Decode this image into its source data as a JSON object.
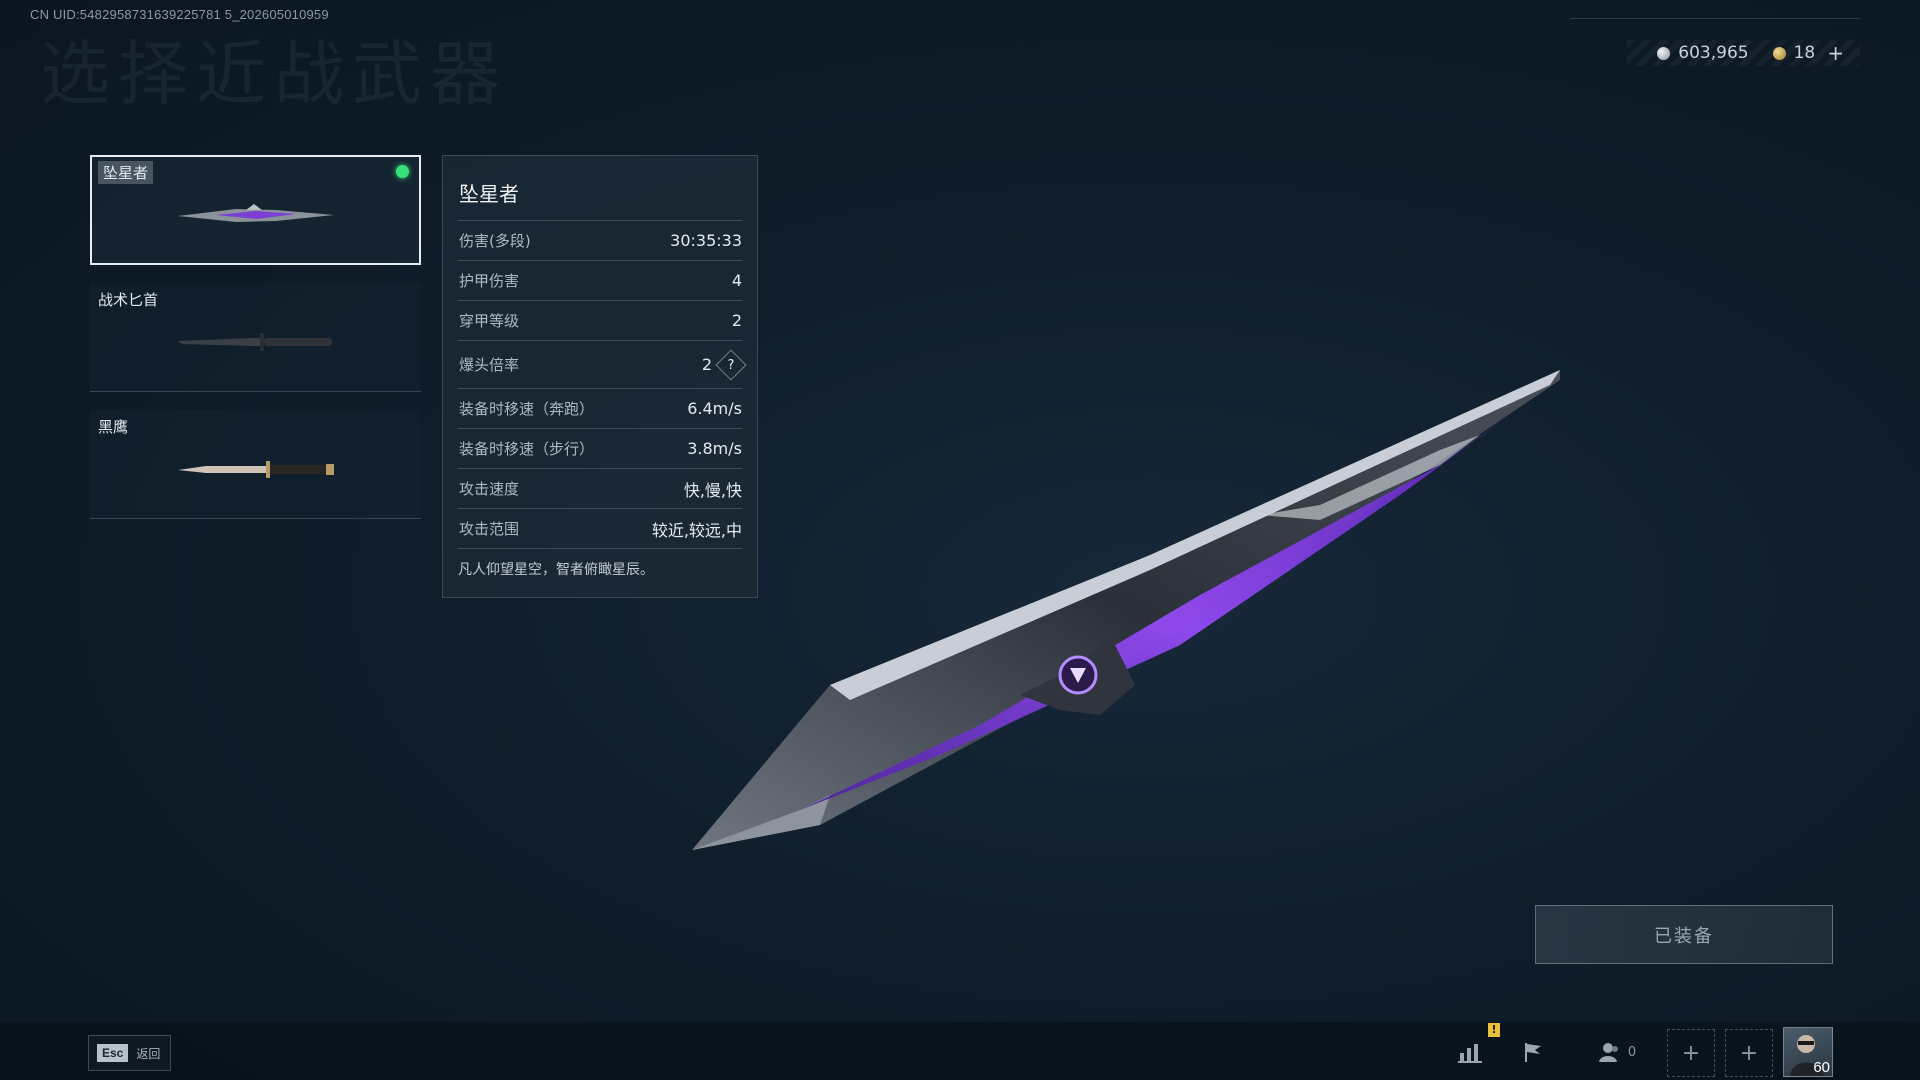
{
  "uid_text": "CN UID:5482958731639225781 5_202605010959",
  "page": {
    "ghost_title": "选择近战武器"
  },
  "currency": [
    {
      "icon": "silver-coin-icon",
      "value": "603,965"
    },
    {
      "icon": "gold-coin-icon",
      "value": "18"
    }
  ],
  "currency_plus": "+",
  "weapons": [
    {
      "name": "坠星者",
      "selected": true,
      "equipped": true
    },
    {
      "name": "战术匕首",
      "selected": false,
      "equipped": false
    },
    {
      "name": "黑鹰",
      "selected": false,
      "equipped": false
    }
  ],
  "stats": {
    "title": "坠星者",
    "rows": [
      {
        "label": "伤害(多段)",
        "value": "30:35:33"
      },
      {
        "label": "护甲伤害",
        "value": "4"
      },
      {
        "label": "穿甲等级",
        "value": "2"
      },
      {
        "label": "爆头倍率",
        "value": "2",
        "help": "?"
      },
      {
        "label": "装备时移速（奔跑）",
        "value": "6.4m/s"
      },
      {
        "label": "装备时移速（步行）",
        "value": "3.8m/s"
      },
      {
        "label": "攻击速度",
        "value": "快,慢,快"
      },
      {
        "label": "攻击范围",
        "value": "较近,较远,中"
      }
    ],
    "description": "凡人仰望星空，智者俯瞰星辰。"
  },
  "equip_button": "已装备",
  "bottom": {
    "esc_key": "Esc",
    "esc_label": "返回",
    "friends_count": "0",
    "warn_mark": "!",
    "avatar_level": "60",
    "add_glyph": "+"
  },
  "colors": {
    "equipped_dot": "#37e07a",
    "blade_accent": "#8a3cf0"
  }
}
